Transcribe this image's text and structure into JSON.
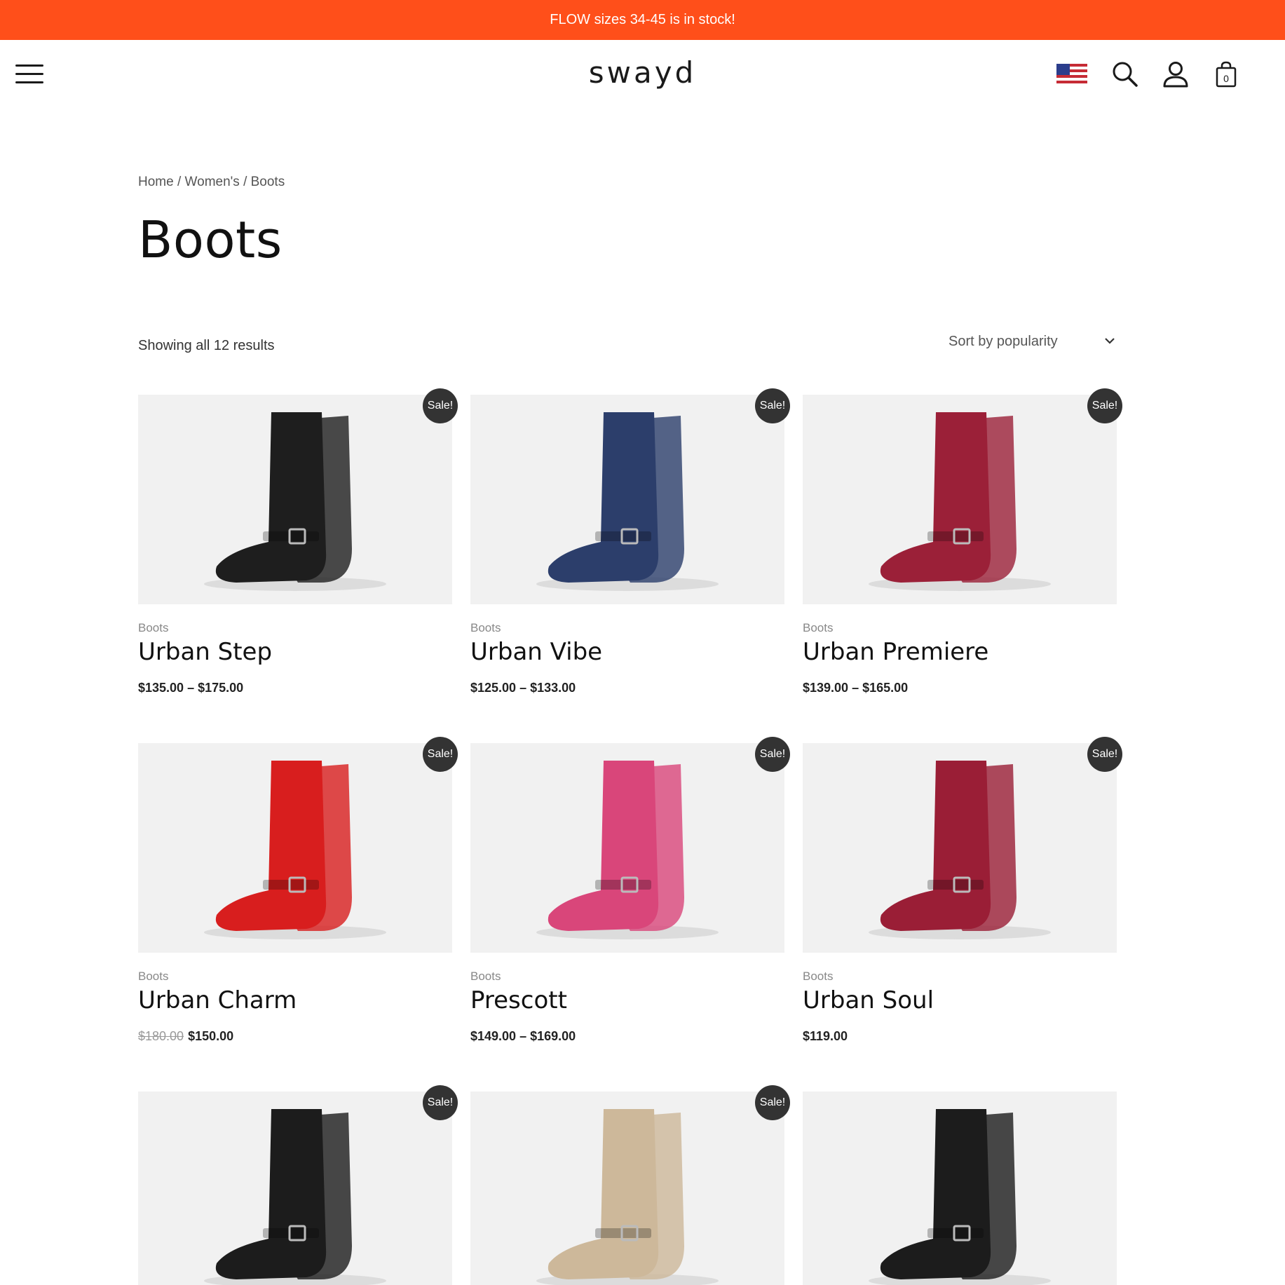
{
  "announcement": "FLOW sizes 34-45 is in stock!",
  "header": {
    "logo": "swayd",
    "cart_count": "0"
  },
  "breadcrumb": [
    "Home",
    "Women's",
    "Boots"
  ],
  "breadcrumb_sep": "/",
  "page_title": "Boots",
  "result_count": "Showing all 12 results",
  "sort": {
    "selected": "Sort by popularity"
  },
  "colors": {
    "accent": "#ff4f1a",
    "badge": "#333333"
  },
  "products": [
    {
      "category": "Boots",
      "title": "Urban Step",
      "price": "$135.00 – $175.00",
      "old_price": "",
      "sale": "Sale!",
      "color": "#1e1e1e"
    },
    {
      "category": "Boots",
      "title": "Urban Vibe",
      "price": "$125.00 – $133.00",
      "old_price": "",
      "sale": "Sale!",
      "color": "#2c3e6b"
    },
    {
      "category": "Boots",
      "title": "Urban Premiere",
      "price": "$139.00 – $165.00",
      "old_price": "",
      "sale": "Sale!",
      "color": "#9b2038"
    },
    {
      "category": "Boots",
      "title": "Urban Charm",
      "price": "$150.00",
      "old_price": "$180.00",
      "sale": "Sale!",
      "color": "#d81e1e"
    },
    {
      "category": "Boots",
      "title": "Prescott",
      "price": "$149.00 – $169.00",
      "old_price": "",
      "sale": "Sale!",
      "color": "#d9467a"
    },
    {
      "category": "Boots",
      "title": "Urban Soul",
      "price": "$119.00",
      "old_price": "",
      "sale": "Sale!",
      "color": "#9a1e36"
    },
    {
      "category": "",
      "title": "",
      "price": "",
      "old_price": "",
      "sale": "Sale!",
      "color": "#1c1c1c"
    },
    {
      "category": "",
      "title": "",
      "price": "",
      "old_price": "",
      "sale": "Sale!",
      "color": "#cdb89a"
    },
    {
      "category": "",
      "title": "",
      "price": "",
      "old_price": "",
      "sale": "",
      "color": "#1c1c1c"
    }
  ]
}
